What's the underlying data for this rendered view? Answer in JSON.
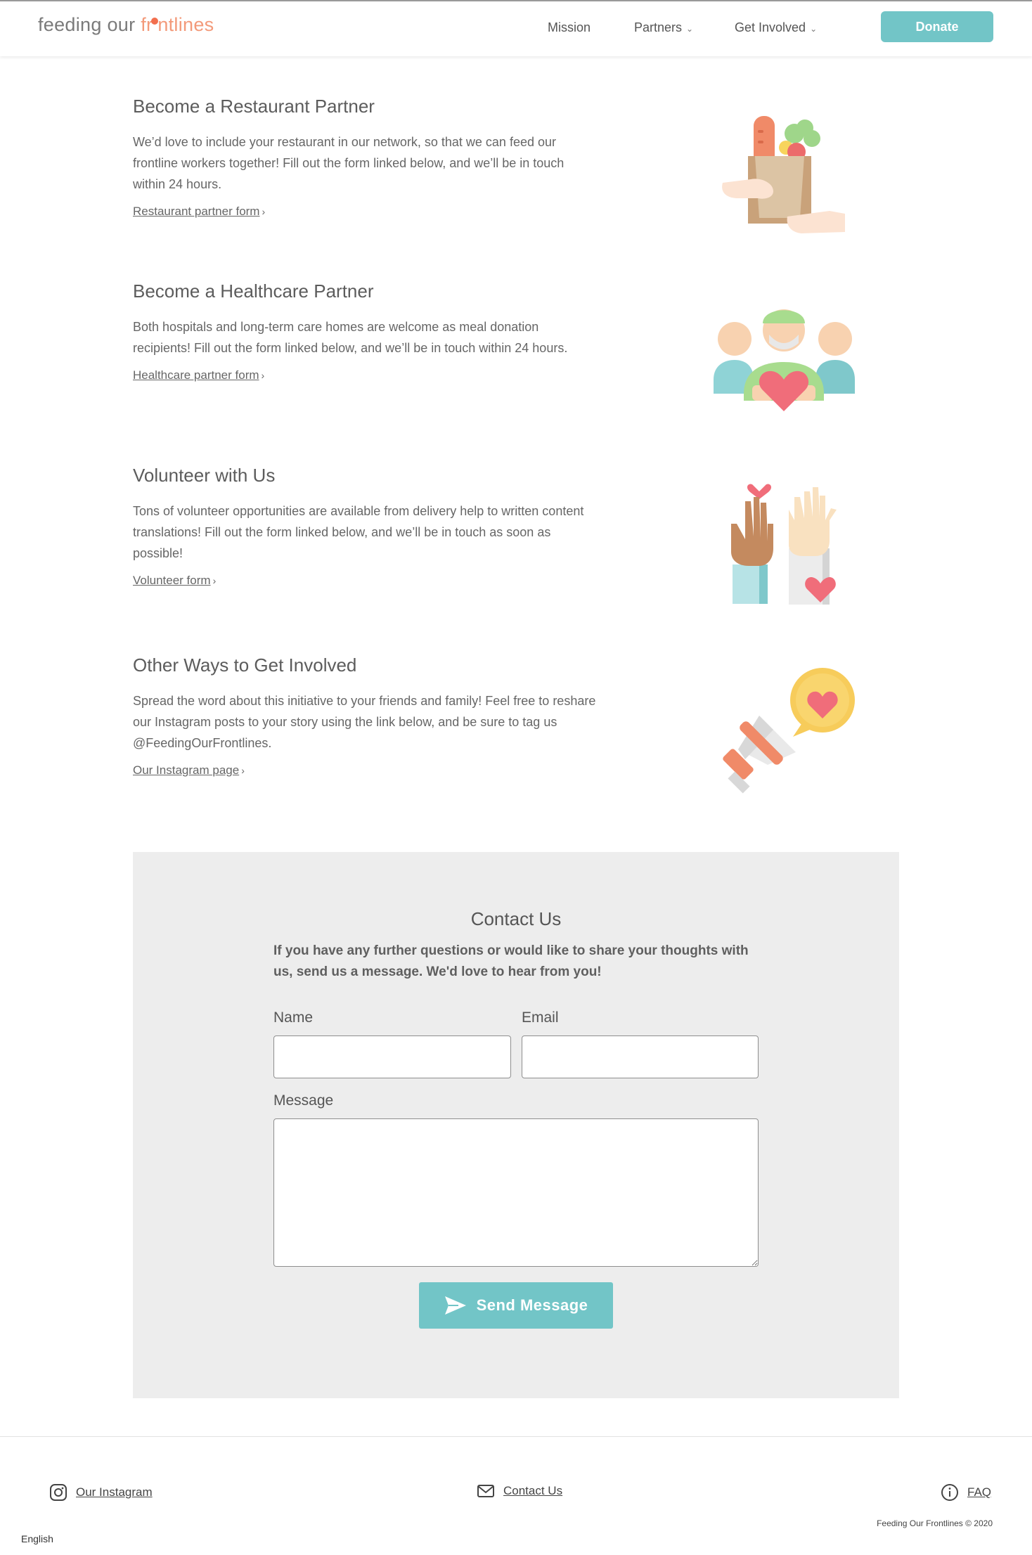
{
  "header": {
    "logo": {
      "part1": "feeding our ",
      "part2_a": "fr",
      "part2_b": "ntlines"
    },
    "nav": [
      {
        "label": "Mission",
        "has_dropdown": false
      },
      {
        "label": "Partners",
        "has_dropdown": true
      },
      {
        "label": "Get Involved",
        "has_dropdown": true
      }
    ],
    "donate_label": "Donate"
  },
  "sections": [
    {
      "title": "Become a Restaurant Partner",
      "body": "We’d love to include your restaurant in our network, so that we can feed our frontline workers together! Fill out the form linked below, and we’ll be in touch within 24 hours.",
      "link": "Restaurant partner form",
      "icon": "grocery-bag-hands-icon"
    },
    {
      "title": "Become a Healthcare Partner",
      "body": "Both hospitals and long-term care homes are welcome as meal donation recipients! Fill out the form linked below, and we’ll be in touch within 24 hours.",
      "link": "Healthcare partner form",
      "icon": "healthcare-workers-heart-icon"
    },
    {
      "title": "Volunteer with Us",
      "body": "Tons of volunteer opportunities are available from delivery help to written content translations! Fill out the form linked below, and we’ll be in touch as soon as possible!",
      "link": "Volunteer form",
      "icon": "raised-hands-hearts-icon"
    },
    {
      "title": "Other Ways to Get Involved",
      "body": "Spread the word about this initiative to your friends and family! Feel free to reshare our Instagram posts to your story using the link below, and be sure to tag us @FeedingOurFrontlines.",
      "link": "Our Instagram page",
      "icon": "megaphone-heart-icon"
    }
  ],
  "contact": {
    "title": "Contact Us",
    "intro": "If you have any further questions or would like to share your thoughts with us, send us a message. We'd love to hear from you!",
    "name_label": "Name",
    "name_value": "",
    "email_label": "Email",
    "email_value": "",
    "message_label": "Message",
    "message_value": "",
    "send_label": "Send Message"
  },
  "footer": {
    "instagram_label": "Our Instagram",
    "contact_label": "Contact Us",
    "faq_label": "FAQ",
    "copyright": "Feeding Our Frontlines © 2020",
    "language": "English"
  },
  "colors": {
    "accent_teal": "#72c5c7",
    "logo_orange": "#f39a7a",
    "contact_bg": "#ededed"
  }
}
